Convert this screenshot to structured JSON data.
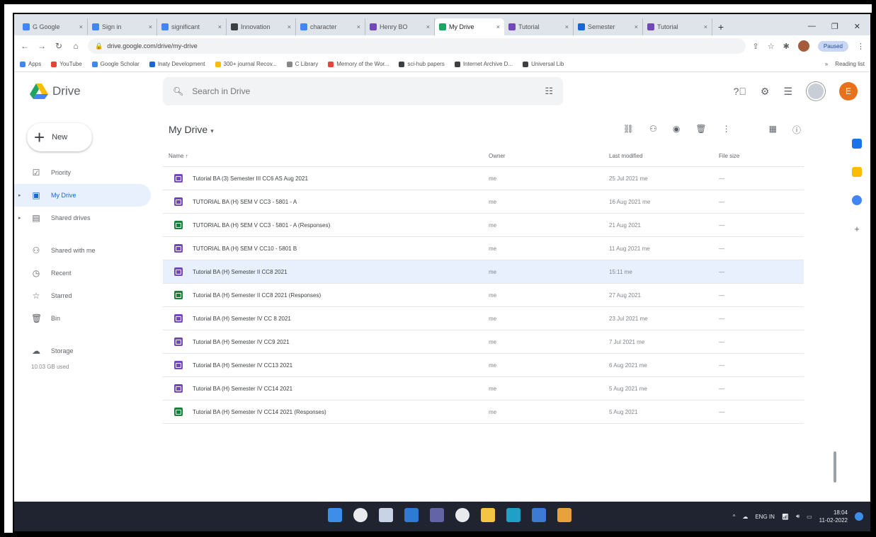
{
  "browser": {
    "tabs": [
      {
        "label": "G Google",
        "color": "#4285f4"
      },
      {
        "label": "Sign in",
        "color": "#4285f4"
      },
      {
        "label": "significant",
        "color": "#4285f4"
      },
      {
        "label": "Innovation",
        "color": "#3c4043"
      },
      {
        "label": "character",
        "color": "#4285f4"
      },
      {
        "label": "Henry BO",
        "color": "#7248b9"
      },
      {
        "label": "My Drive",
        "color": "#1fa463",
        "active": true
      },
      {
        "label": "Tutorial",
        "color": "#7248b9"
      },
      {
        "label": "Semester",
        "color": "#1967d2"
      },
      {
        "label": "Tutorial",
        "color": "#7248b9"
      }
    ],
    "newtab_label": "+",
    "url": "drive.google.com/drive/my-drive",
    "profile_status": "Paused",
    "bookmarks": [
      {
        "label": "Apps",
        "color": "#4285f4"
      },
      {
        "label": "YouTube",
        "color": "#ea4335"
      },
      {
        "label": "Google Scholar",
        "color": "#4285f4"
      },
      {
        "label": "Inaty Development",
        "color": "#1967d2"
      },
      {
        "label": "300+ journal Recov...",
        "color": "#fbbc04"
      },
      {
        "label": "C Library",
        "color": "#888888"
      },
      {
        "label": "Memory of the Wor...",
        "color": "#ea4335"
      },
      {
        "label": "sci-hub papers",
        "color": "#3c4043"
      },
      {
        "label": "Internet Archive D...",
        "color": "#3c4043"
      },
      {
        "label": "Universal Lib",
        "color": "#3c4043"
      }
    ],
    "reading_list": "Reading list"
  },
  "drive": {
    "app_name": "Drive",
    "search_placeholder": "Search in Drive",
    "new_button": "New",
    "nav": [
      {
        "label": "Priority",
        "icon": "priority-icon",
        "glyph": "☑",
        "active": false,
        "caret": false
      },
      {
        "label": "My Drive",
        "icon": "my-drive-icon",
        "glyph": "▣",
        "active": true,
        "caret": true
      },
      {
        "label": "Shared drives",
        "icon": "shared-drives-icon",
        "glyph": "▤",
        "active": false,
        "caret": true
      },
      {
        "label": "Shared with me",
        "icon": "shared-with-me-icon",
        "glyph": "⚇",
        "active": false,
        "caret": false,
        "gap_before": true
      },
      {
        "label": "Recent",
        "icon": "recent-icon",
        "glyph": "◷",
        "active": false,
        "caret": false
      },
      {
        "label": "Starred",
        "icon": "starred-icon",
        "glyph": "☆",
        "active": false,
        "caret": false
      },
      {
        "label": "Bin",
        "icon": "bin-icon",
        "glyph": "🗑",
        "active": false,
        "caret": false
      },
      {
        "label": "Storage",
        "icon": "cloud-icon",
        "glyph": "☁",
        "active": false,
        "caret": false,
        "gap_before": true
      }
    ],
    "storage_used": "10.03 GB used",
    "location_title": "My Drive",
    "columns": {
      "name": "Name",
      "owner": "Owner",
      "modified": "Last modified",
      "size": "File size"
    },
    "files": [
      {
        "name": "Tutorial BA (3) Semester III CC6 AS Aug 2021",
        "type": "form",
        "owner": "me",
        "modified": "25 Jul 2021 me",
        "size": "—"
      },
      {
        "name": "TUTORIAL BA (H) SEM V CC3 - 5801 - A",
        "type": "form",
        "owner": "me",
        "modified": "16 Aug 2021 me",
        "size": "—"
      },
      {
        "name": "TUTORIAL BA (H) SEM V CC3 - 5801 - A (Responses)",
        "type": "sheet",
        "owner": "me",
        "modified": "21 Aug 2021",
        "size": "—"
      },
      {
        "name": "TUTORIAL BA (H) SEM V CC10 - 5801 B",
        "type": "form",
        "owner": "me",
        "modified": "11 Aug 2021 me",
        "size": "—"
      },
      {
        "name": "Tutorial BA (H) Semester II CC8 2021",
        "type": "form",
        "owner": "me",
        "modified": "15:11 me",
        "size": "—",
        "selected": true
      },
      {
        "name": "Tutorial BA (H) Semester II CC8 2021 (Responses)",
        "type": "sheet",
        "owner": "me",
        "modified": "27 Aug 2021",
        "size": "—"
      },
      {
        "name": "Tutorial BA (H) Semester IV CC 8 2021",
        "type": "form",
        "owner": "me",
        "modified": "23 Jul 2021 me",
        "size": "—"
      },
      {
        "name": "Tutorial BA (H) Semester IV CC9 2021",
        "type": "form",
        "owner": "me",
        "modified": "7 Jul 2021 me",
        "size": "—"
      },
      {
        "name": "Tutorial BA (H) Semester IV CC13 2021",
        "type": "form",
        "owner": "me",
        "modified": "6 Aug 2021 me",
        "size": "—"
      },
      {
        "name": "Tutorial BA (H) Semester IV CC14 2021",
        "type": "form",
        "owner": "me",
        "modified": "5 Aug 2021 me",
        "size": "—"
      },
      {
        "name": "Tutorial BA (H) Semester IV CC14 2021 (Responses)",
        "type": "sheet",
        "owner": "me",
        "modified": "5 Aug 2021",
        "size": "—"
      }
    ],
    "user_initial": "E"
  },
  "taskbar": {
    "apps": [
      {
        "name": "start",
        "color": "#3d8ee8"
      },
      {
        "name": "search",
        "color": "#e8eaed"
      },
      {
        "name": "task-view",
        "color": "#c9d3e6"
      },
      {
        "name": "widgets",
        "color": "#2e7bd6"
      },
      {
        "name": "chat",
        "color": "#6264a7"
      },
      {
        "name": "chrome",
        "color": "#e8eaed"
      },
      {
        "name": "file-explorer",
        "color": "#f4c542"
      },
      {
        "name": "edge",
        "color": "#1fa0c7"
      },
      {
        "name": "store",
        "color": "#3b7bd4"
      },
      {
        "name": "photos",
        "color": "#e9a23b"
      }
    ],
    "language": "ENG IN",
    "time": "18:04",
    "date": "11-02-2022"
  }
}
